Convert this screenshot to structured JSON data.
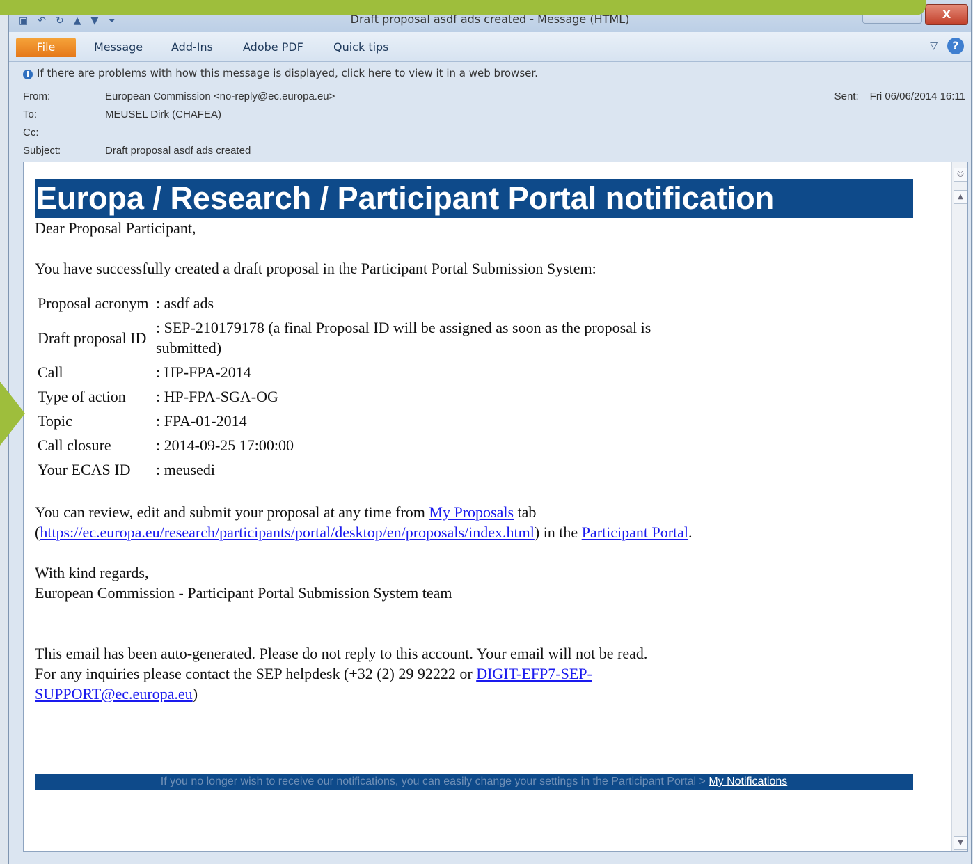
{
  "window": {
    "title": "Draft proposal asdf ads created - Message (HTML)",
    "close_label": "X"
  },
  "ribbon": {
    "tabs": [
      "File",
      "Message",
      "Add-Ins",
      "Adobe PDF",
      "Quick tips"
    ],
    "help_label": "?",
    "minimize_label": "▽"
  },
  "infobar": {
    "text": "If there are problems with how this message is displayed, click here to view it in a web browser."
  },
  "header": {
    "from_label": "From:",
    "from_value": "European Commission <no-reply@ec.europa.eu>",
    "to_label": "To:",
    "to_value": "MEUSEL Dirk (CHAFEA)",
    "cc_label": "Cc:",
    "cc_value": "",
    "subject_label": "Subject:",
    "subject_value": "Draft proposal asdf ads created",
    "sent_label": "Sent:",
    "sent_value": "Fri 06/06/2014 16:11"
  },
  "email": {
    "banner": "Europa / Research / Participant Portal notification",
    "greeting": "Dear Proposal Participant,",
    "intro": "You have successfully created a draft proposal in the Participant Portal Submission System:",
    "details": [
      {
        "label": "Proposal acronym",
        "value": ": asdf ads"
      },
      {
        "label": "Draft proposal ID",
        "value": ": SEP-210179178 (a final Proposal ID will be assigned as soon as the proposal is submitted)"
      },
      {
        "label": "Call",
        "value": ": HP-FPA-2014"
      },
      {
        "label": "Type of action",
        "value": ": HP-FPA-SGA-OG"
      },
      {
        "label": "Topic",
        "value": ": FPA-01-2014"
      },
      {
        "label": "Call closure",
        "value": ": 2014-09-25 17:00:00"
      },
      {
        "label": "Your ECAS ID",
        "value": ": meusedi"
      }
    ],
    "review_pre": "You can review, edit and submit your proposal at any time from ",
    "review_link1": "My Proposals",
    "review_mid1": " tab (",
    "review_url": "https://ec.europa.eu/research/participants/portal/desktop/en/proposals/index.html",
    "review_mid2": ") in the ",
    "review_link2": "Participant Portal",
    "review_end": ".",
    "regards": "With kind regards,",
    "signature": "European Commission - Participant Portal Submission System team",
    "auto_generated": "This email has been auto-generated. Please do not reply to this account. Your email will not be read.",
    "inquiries_pre": "For any inquiries please contact the SEP helpdesk (+32 (2) 29 92222 or ",
    "inquiries_email": "DIGIT-EFP7-SEP-SUPPORT@ec.europa.eu",
    "inquiries_end": ")",
    "footer_text": "If you no longer wish to receive our notifications, you can easily change your settings in the Participant Portal > ",
    "footer_link": "My Notifications"
  }
}
